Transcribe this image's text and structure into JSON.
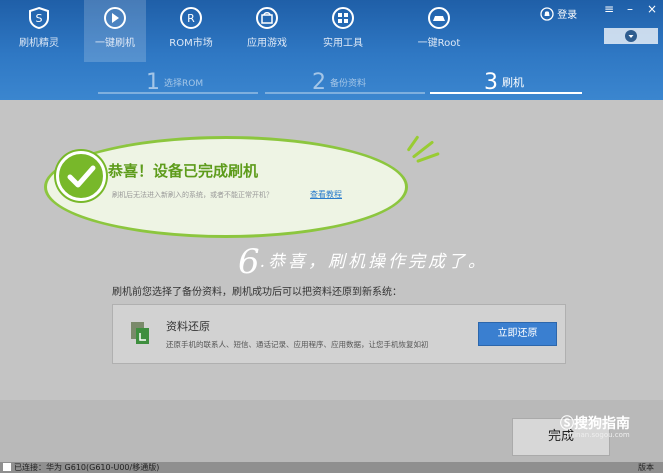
{
  "nav": {
    "items": [
      {
        "label": "刷机精灵",
        "icon": "shield-s-icon"
      },
      {
        "label": "一键刷机",
        "icon": "flash-arrow-icon",
        "active": true
      },
      {
        "label": "ROM市场",
        "icon": "rom-r-icon"
      },
      {
        "label": "应用游戏",
        "icon": "bag-icon"
      },
      {
        "label": "实用工具",
        "icon": "grid-tools-icon"
      },
      {
        "label": "一键Root",
        "icon": "root-car-icon"
      }
    ],
    "login_label": "登录"
  },
  "steps": [
    {
      "num": "1",
      "label": "选择ROM"
    },
    {
      "num": "2",
      "label": "备份资料"
    },
    {
      "num": "3",
      "label": "刷机",
      "active": true
    }
  ],
  "success": {
    "title": "恭喜！设备已完成刷机",
    "subtitle": "刷机后无法进入新刷入的系统，或者不能正常开机？",
    "link": "查看教程"
  },
  "annotation": {
    "number": "6",
    "text": ".恭喜，刷机操作完成了。"
  },
  "backup": {
    "note": "刷机前您选择了备份资料，刷机成功后可以把资料还原到新系统：",
    "title": "资料还原",
    "desc": "还原手机的联系人、短信、通话记录、应用程序、应用数据，让您手机恢复如初",
    "button": "立即还原"
  },
  "footer": {
    "finish": "完成",
    "status": "已连接：华为 G610(G610-U00/移通版)",
    "right_status": "版本",
    "watermark": "搜狗指南",
    "watermark_sub": "zhinan.sogou.com"
  },
  "colors": {
    "accent_blue": "#2f78c4",
    "success_green": "#78b82a",
    "link_blue": "#2a7ccc"
  }
}
